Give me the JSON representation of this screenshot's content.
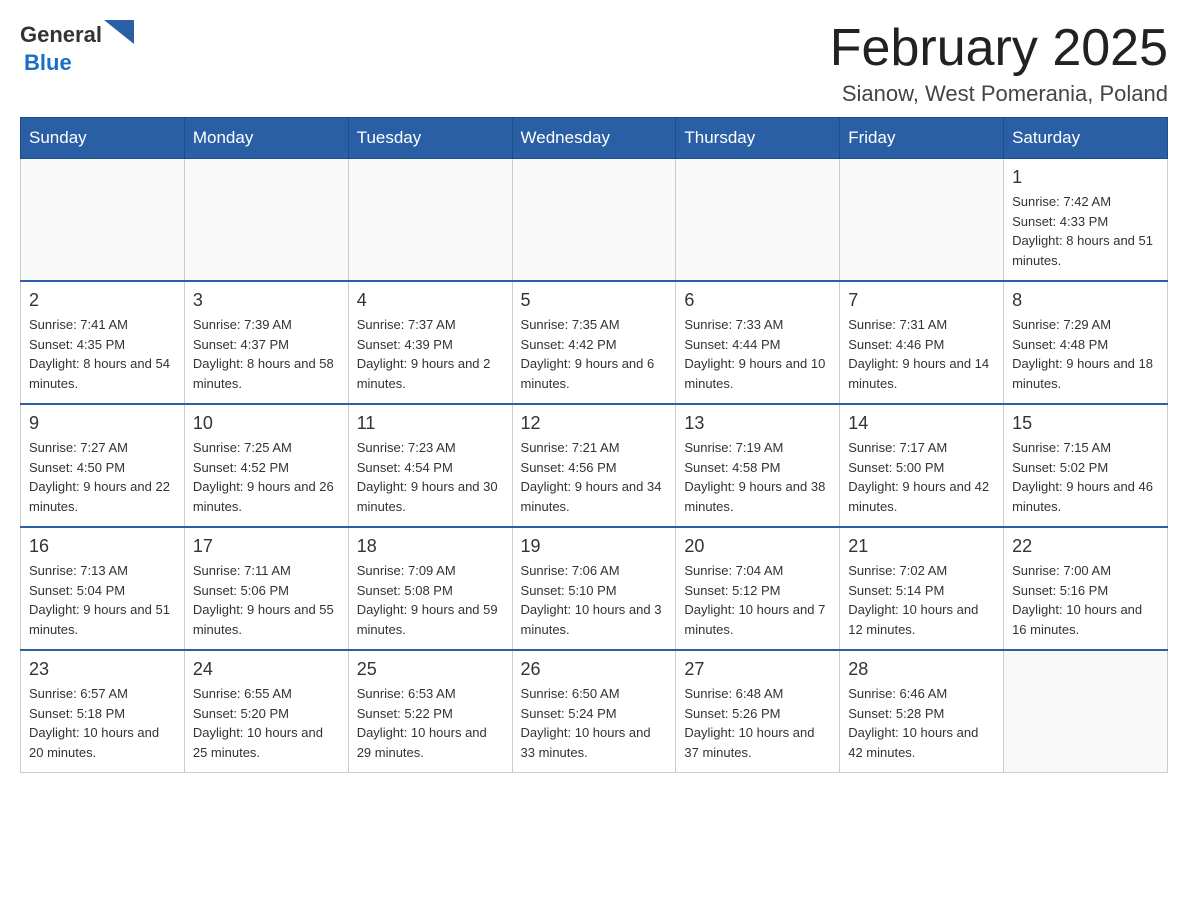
{
  "header": {
    "logo_general": "General",
    "logo_blue": "Blue",
    "title": "February 2025",
    "subtitle": "Sianow, West Pomerania, Poland"
  },
  "weekdays": [
    "Sunday",
    "Monday",
    "Tuesday",
    "Wednesday",
    "Thursday",
    "Friday",
    "Saturday"
  ],
  "weeks": [
    {
      "days": [
        {
          "num": "",
          "info": ""
        },
        {
          "num": "",
          "info": ""
        },
        {
          "num": "",
          "info": ""
        },
        {
          "num": "",
          "info": ""
        },
        {
          "num": "",
          "info": ""
        },
        {
          "num": "",
          "info": ""
        },
        {
          "num": "1",
          "info": "Sunrise: 7:42 AM\nSunset: 4:33 PM\nDaylight: 8 hours and 51 minutes."
        }
      ]
    },
    {
      "days": [
        {
          "num": "2",
          "info": "Sunrise: 7:41 AM\nSunset: 4:35 PM\nDaylight: 8 hours and 54 minutes."
        },
        {
          "num": "3",
          "info": "Sunrise: 7:39 AM\nSunset: 4:37 PM\nDaylight: 8 hours and 58 minutes."
        },
        {
          "num": "4",
          "info": "Sunrise: 7:37 AM\nSunset: 4:39 PM\nDaylight: 9 hours and 2 minutes."
        },
        {
          "num": "5",
          "info": "Sunrise: 7:35 AM\nSunset: 4:42 PM\nDaylight: 9 hours and 6 minutes."
        },
        {
          "num": "6",
          "info": "Sunrise: 7:33 AM\nSunset: 4:44 PM\nDaylight: 9 hours and 10 minutes."
        },
        {
          "num": "7",
          "info": "Sunrise: 7:31 AM\nSunset: 4:46 PM\nDaylight: 9 hours and 14 minutes."
        },
        {
          "num": "8",
          "info": "Sunrise: 7:29 AM\nSunset: 4:48 PM\nDaylight: 9 hours and 18 minutes."
        }
      ]
    },
    {
      "days": [
        {
          "num": "9",
          "info": "Sunrise: 7:27 AM\nSunset: 4:50 PM\nDaylight: 9 hours and 22 minutes."
        },
        {
          "num": "10",
          "info": "Sunrise: 7:25 AM\nSunset: 4:52 PM\nDaylight: 9 hours and 26 minutes."
        },
        {
          "num": "11",
          "info": "Sunrise: 7:23 AM\nSunset: 4:54 PM\nDaylight: 9 hours and 30 minutes."
        },
        {
          "num": "12",
          "info": "Sunrise: 7:21 AM\nSunset: 4:56 PM\nDaylight: 9 hours and 34 minutes."
        },
        {
          "num": "13",
          "info": "Sunrise: 7:19 AM\nSunset: 4:58 PM\nDaylight: 9 hours and 38 minutes."
        },
        {
          "num": "14",
          "info": "Sunrise: 7:17 AM\nSunset: 5:00 PM\nDaylight: 9 hours and 42 minutes."
        },
        {
          "num": "15",
          "info": "Sunrise: 7:15 AM\nSunset: 5:02 PM\nDaylight: 9 hours and 46 minutes."
        }
      ]
    },
    {
      "days": [
        {
          "num": "16",
          "info": "Sunrise: 7:13 AM\nSunset: 5:04 PM\nDaylight: 9 hours and 51 minutes."
        },
        {
          "num": "17",
          "info": "Sunrise: 7:11 AM\nSunset: 5:06 PM\nDaylight: 9 hours and 55 minutes."
        },
        {
          "num": "18",
          "info": "Sunrise: 7:09 AM\nSunset: 5:08 PM\nDaylight: 9 hours and 59 minutes."
        },
        {
          "num": "19",
          "info": "Sunrise: 7:06 AM\nSunset: 5:10 PM\nDaylight: 10 hours and 3 minutes."
        },
        {
          "num": "20",
          "info": "Sunrise: 7:04 AM\nSunset: 5:12 PM\nDaylight: 10 hours and 7 minutes."
        },
        {
          "num": "21",
          "info": "Sunrise: 7:02 AM\nSunset: 5:14 PM\nDaylight: 10 hours and 12 minutes."
        },
        {
          "num": "22",
          "info": "Sunrise: 7:00 AM\nSunset: 5:16 PM\nDaylight: 10 hours and 16 minutes."
        }
      ]
    },
    {
      "days": [
        {
          "num": "23",
          "info": "Sunrise: 6:57 AM\nSunset: 5:18 PM\nDaylight: 10 hours and 20 minutes."
        },
        {
          "num": "24",
          "info": "Sunrise: 6:55 AM\nSunset: 5:20 PM\nDaylight: 10 hours and 25 minutes."
        },
        {
          "num": "25",
          "info": "Sunrise: 6:53 AM\nSunset: 5:22 PM\nDaylight: 10 hours and 29 minutes."
        },
        {
          "num": "26",
          "info": "Sunrise: 6:50 AM\nSunset: 5:24 PM\nDaylight: 10 hours and 33 minutes."
        },
        {
          "num": "27",
          "info": "Sunrise: 6:48 AM\nSunset: 5:26 PM\nDaylight: 10 hours and 37 minutes."
        },
        {
          "num": "28",
          "info": "Sunrise: 6:46 AM\nSunset: 5:28 PM\nDaylight: 10 hours and 42 minutes."
        },
        {
          "num": "",
          "info": ""
        }
      ]
    }
  ]
}
